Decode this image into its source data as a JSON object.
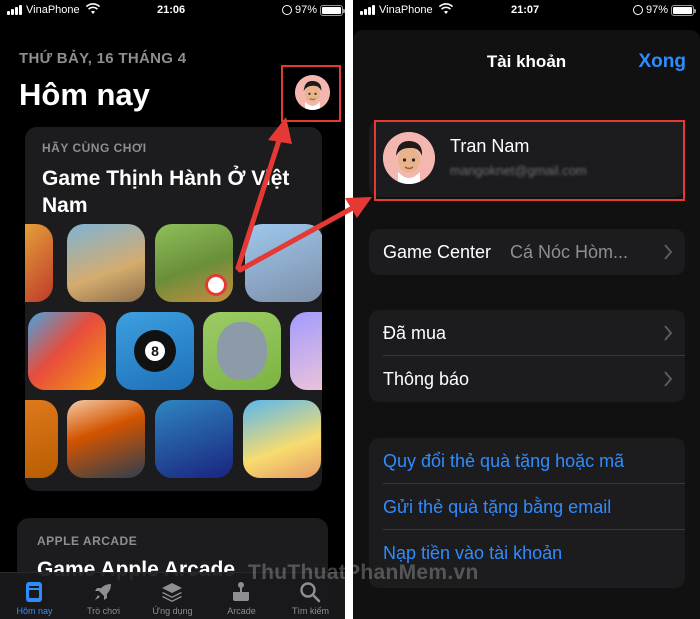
{
  "left": {
    "status": {
      "carrier": "VinaPhone",
      "time": "21:06",
      "battery": "97%"
    },
    "date_line": "THỨ BẢY, 16 THÁNG 4",
    "page_title": "Hôm nay",
    "card1": {
      "kicker": "HÃY CÙNG CHƠI",
      "headline": "Game Thịnh Hành Ở Việt Nam"
    },
    "card2": {
      "kicker": "APPLE ARCADE",
      "headline": "Game Apple Arcade"
    },
    "tabs": [
      {
        "label": "Hôm nay",
        "icon": "today-icon",
        "active": true
      },
      {
        "label": "Trò chơi",
        "icon": "rocket-icon",
        "active": false
      },
      {
        "label": "Ứng dụng",
        "icon": "layers-icon",
        "active": false
      },
      {
        "label": "Arcade",
        "icon": "arcade-icon",
        "active": false
      },
      {
        "label": "Tìm kiếm",
        "icon": "search-icon",
        "active": false
      }
    ]
  },
  "right": {
    "status": {
      "carrier": "VinaPhone",
      "time": "21:07",
      "battery": "97%"
    },
    "sheet_title": "Tài khoản",
    "done_label": "Xong",
    "profile": {
      "name": "Tran Nam",
      "email": "mangoknet@gmail.com"
    },
    "game_center": {
      "label": "Game Center",
      "value": "Cá Nóc Hòm..."
    },
    "purchased_label": "Đã mua",
    "notifications_label": "Thông báo",
    "links": [
      "Quy đổi thẻ quà tặng hoặc mã",
      "Gửi thẻ quà tặng bằng email",
      "Nạp tiền vào tài khoản"
    ]
  },
  "watermark": "ThuThuatPhanMem.vn",
  "colors": {
    "accent": "#2f8cff",
    "highlight": "#e53935",
    "background": "#000000",
    "card": "#1c1c1e"
  }
}
